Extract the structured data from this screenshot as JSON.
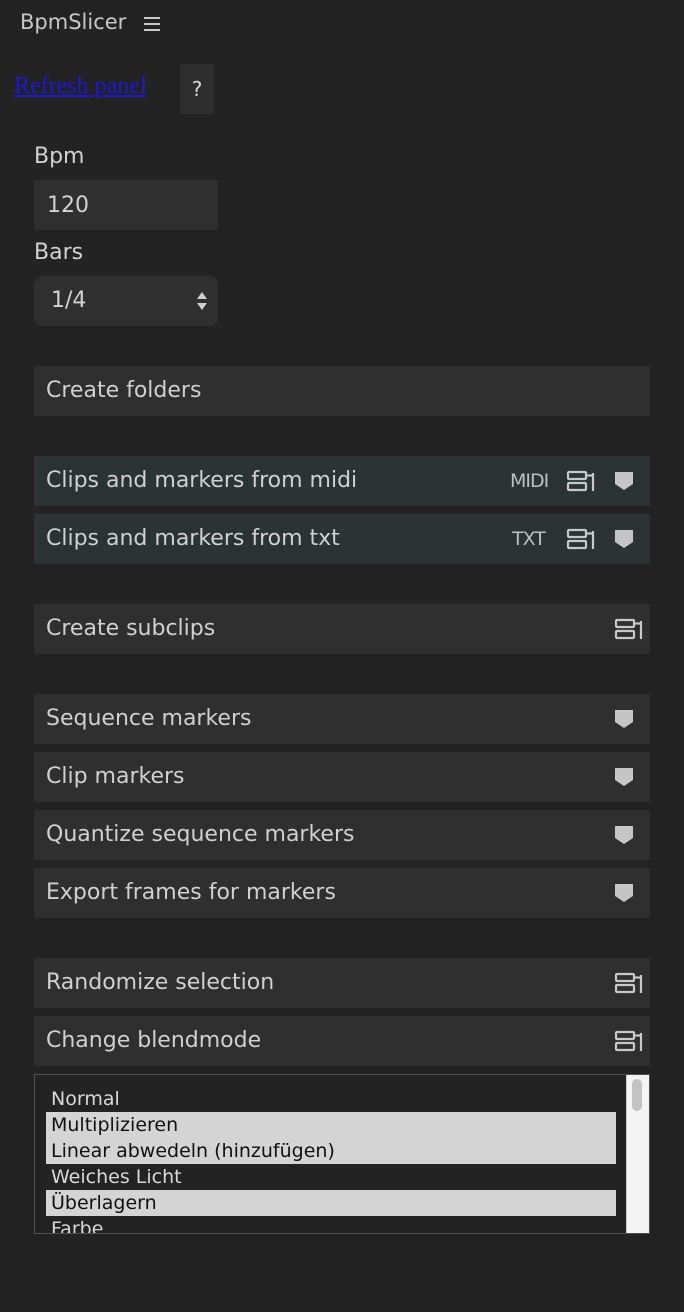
{
  "app": {
    "title": "BpmSlicer"
  },
  "header": {
    "refresh_label": "Refresh panel",
    "help_label": "?"
  },
  "bpm": {
    "label": "Bpm",
    "value": "120"
  },
  "bars": {
    "label": "Bars",
    "selected": "1/4"
  },
  "buttons": {
    "create_folders": "Create folders",
    "clips_midi": "Clips and markers from midi",
    "clips_txt": "Clips and markers from txt",
    "create_subclips": "Create subclips",
    "sequence_markers": "Sequence markers",
    "clip_markers": "Clip markers",
    "quantize_sequence_markers": "Quantize sequence markers",
    "export_frames": "Export frames for markers",
    "randomize_selection": "Randomize selection",
    "change_blendmode": "Change blendmode"
  },
  "icon_text": {
    "midi": "MIDI",
    "txt": "TXT"
  },
  "icons": {
    "menu": "hamburger-icon",
    "clip": "clip-icon",
    "marker": "marker-icon",
    "select_arrows": "updown-arrows-icon"
  },
  "blendmodes": {
    "options": [
      {
        "label": "Normal",
        "selected": false
      },
      {
        "label": "Multiplizieren",
        "selected": true
      },
      {
        "label": "Linear abwedeln (hinzufügen)",
        "selected": true
      },
      {
        "label": "Weiches Licht",
        "selected": false
      },
      {
        "label": "Überlagern",
        "selected": true
      },
      {
        "label": "Farbe",
        "selected": false
      }
    ]
  },
  "colors": {
    "background": "#232323",
    "button": "#2f2f2f",
    "button_teal": "#2b3333",
    "link": "#1d1ad8",
    "list_selected": "#d4d4d4"
  }
}
